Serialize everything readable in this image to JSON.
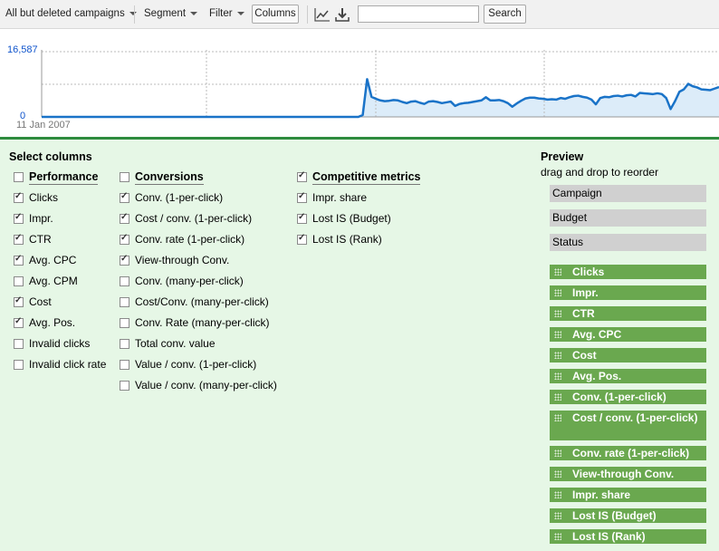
{
  "toolbar": {
    "campaign_filter": "All but deleted campaigns",
    "segment": "Segment",
    "filter": "Filter",
    "columns": "Columns",
    "search_button": "Search",
    "search_value": ""
  },
  "chart": {
    "y_max_label": "16,587",
    "y_min_label": "0",
    "x_start_label": "11 Jan 2007"
  },
  "chart_data": {
    "type": "area",
    "ylim": [
      0,
      16587
    ],
    "y_ticks": [
      "16,587",
      "0"
    ],
    "x_tick_labels": [
      "11 Jan 2007"
    ],
    "grid": true,
    "series": [
      {
        "values": [
          0,
          0,
          0,
          0,
          0,
          0,
          0,
          0,
          0,
          0,
          0,
          0,
          0,
          0,
          0,
          0,
          0,
          0,
          0,
          0,
          0,
          0,
          0,
          0,
          0,
          0,
          0,
          0,
          0,
          0,
          0,
          0,
          0,
          0,
          0,
          0,
          0,
          0,
          0,
          0,
          0,
          0,
          0,
          0,
          0,
          0,
          0,
          0,
          0,
          0,
          0,
          0,
          0,
          0,
          0,
          0,
          0,
          0,
          0,
          0,
          0,
          0,
          0,
          0,
          0,
          0,
          0,
          0,
          0,
          0,
          0,
          0,
          0,
          500,
          9600,
          5100,
          4600,
          4200,
          4000,
          4100,
          4300,
          4200,
          3800,
          3500,
          3900,
          4000,
          3600,
          3300,
          3900,
          4000,
          3800,
          3500,
          3700,
          3900,
          2800,
          3300,
          3500,
          3600,
          3800,
          4000,
          4200,
          5000,
          4200,
          4200,
          4300,
          4000,
          3500,
          2600,
          3400,
          4100,
          4700,
          4900,
          4900,
          4700,
          4600,
          4400,
          4500,
          4400,
          4800,
          4600,
          5000,
          5300,
          5400,
          5100,
          4900,
          4400,
          3200,
          4800,
          5100,
          5000,
          5300,
          5400,
          5200,
          5500,
          5600,
          5200,
          6100,
          6000,
          5900,
          5800,
          6000,
          5800,
          4800,
          2000,
          4000,
          6400,
          7000,
          8400,
          7800,
          7500,
          7000,
          6900,
          6800,
          7200,
          7600
        ]
      }
    ]
  },
  "select_columns": {
    "title": "Select columns",
    "groups": [
      {
        "header": "Performance",
        "checked": false,
        "items": [
          {
            "label": "Clicks",
            "checked": true
          },
          {
            "label": "Impr.",
            "checked": true
          },
          {
            "label": "CTR",
            "checked": true
          },
          {
            "label": "Avg. CPC",
            "checked": true
          },
          {
            "label": "Avg. CPM",
            "checked": false
          },
          {
            "label": "Cost",
            "checked": true
          },
          {
            "label": "Avg. Pos.",
            "checked": true
          },
          {
            "label": "Invalid clicks",
            "checked": false
          },
          {
            "label": "Invalid click rate",
            "checked": false
          }
        ]
      },
      {
        "header": "Conversions",
        "checked": false,
        "items": [
          {
            "label": "Conv. (1-per-click)",
            "checked": true
          },
          {
            "label": "Cost / conv. (1-per-click)",
            "checked": true
          },
          {
            "label": "Conv. rate (1-per-click)",
            "checked": true
          },
          {
            "label": "View-through Conv.",
            "checked": true
          },
          {
            "label": "Conv. (many-per-click)",
            "checked": false
          },
          {
            "label": "Cost/Conv. (many-per-click)",
            "checked": false
          },
          {
            "label": "Conv. Rate (many-per-click)",
            "checked": false
          },
          {
            "label": "Total conv. value",
            "checked": false
          },
          {
            "label": "Value / conv. (1-per-click)",
            "checked": false
          },
          {
            "label": "Value / conv. (many-per-click)",
            "checked": false
          }
        ]
      },
      {
        "header": "Competitive metrics",
        "checked": true,
        "items": [
          {
            "label": "Impr. share",
            "checked": true
          },
          {
            "label": "Lost IS (Budget)",
            "checked": true
          },
          {
            "label": "Lost IS (Rank)",
            "checked": true
          }
        ]
      }
    ]
  },
  "preview": {
    "title": "Preview",
    "subtitle": "drag and drop to reorder",
    "fixed": [
      "Campaign",
      "Budget",
      "Status"
    ],
    "items": [
      "Clicks",
      "Impr.",
      "CTR",
      "Avg. CPC",
      "Cost",
      "Avg. Pos.",
      "Conv. (1-per-click)",
      "Cost / conv. (1-per-click)",
      "Conv. rate (1-per-click)",
      "View-through Conv.",
      "Impr. share",
      "Lost IS (Budget)",
      "Lost IS (Rank)"
    ]
  },
  "colors": {
    "line": "#1a73c8",
    "fill": "#dcecf9",
    "panel": "#e6f7e6",
    "preview_item": "#6aa84f",
    "divider": "#2e8b3e"
  }
}
